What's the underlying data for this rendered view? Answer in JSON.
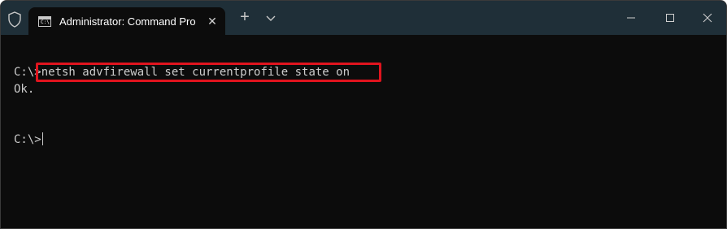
{
  "window": {
    "tab_title": "Administrator: Command Prompt",
    "tab_icon_text": "C:\\",
    "new_tab_symbol": "+",
    "close_tab_symbol": "✕",
    "icons": [
      "shield-icon",
      "cmd-icon",
      "close-icon",
      "plus-icon",
      "chevron-down-icon",
      "minimize-icon",
      "maximize-icon",
      "close-window-icon"
    ]
  },
  "terminal": {
    "prompt1": "C:\\>",
    "command": "netsh advfirewall set currentprofile state on",
    "output": "Ok.",
    "prompt2": "C:\\>"
  },
  "colors": {
    "titlebar": "#1f2f38",
    "background": "#0c0c0c",
    "text": "#cccccc",
    "highlight": "#e0141e"
  }
}
